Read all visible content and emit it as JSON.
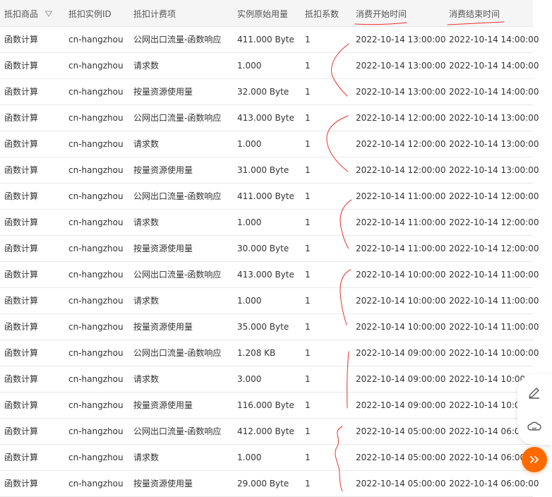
{
  "table": {
    "columns": [
      {
        "key": "product",
        "label": "抵扣商品"
      },
      {
        "key": "instance",
        "label": "抵扣实例ID"
      },
      {
        "key": "item",
        "label": "抵扣计费项"
      },
      {
        "key": "usage",
        "label": "实例原始用量"
      },
      {
        "key": "coef",
        "label": "抵扣系数"
      },
      {
        "key": "start",
        "label": "消费开始时间"
      },
      {
        "key": "end",
        "label": "消费结束时间"
      }
    ],
    "rows": [
      [
        "函数计算",
        "cn-hangzhou",
        "公网出口流量-函数响应",
        "411.000 Byte",
        "1",
        "2022-10-14 13:00:00",
        "2022-10-14 14:00:00"
      ],
      [
        "函数计算",
        "cn-hangzhou",
        "请求数",
        "1.000",
        "1",
        "2022-10-14 13:00:00",
        "2022-10-14 14:00:00"
      ],
      [
        "函数计算",
        "cn-hangzhou",
        "按量资源使用量",
        "32.000 Byte",
        "1",
        "2022-10-14 13:00:00",
        "2022-10-14 14:00:00"
      ],
      [
        "函数计算",
        "cn-hangzhou",
        "公网出口流量-函数响应",
        "413.000 Byte",
        "1",
        "2022-10-14 12:00:00",
        "2022-10-14 13:00:00"
      ],
      [
        "函数计算",
        "cn-hangzhou",
        "请求数",
        "1.000",
        "1",
        "2022-10-14 12:00:00",
        "2022-10-14 13:00:00"
      ],
      [
        "函数计算",
        "cn-hangzhou",
        "按量资源使用量",
        "31.000 Byte",
        "1",
        "2022-10-14 12:00:00",
        "2022-10-14 13:00:00"
      ],
      [
        "函数计算",
        "cn-hangzhou",
        "公网出口流量-函数响应",
        "411.000 Byte",
        "1",
        "2022-10-14 11:00:00",
        "2022-10-14 12:00:00"
      ],
      [
        "函数计算",
        "cn-hangzhou",
        "请求数",
        "1.000",
        "1",
        "2022-10-14 11:00:00",
        "2022-10-14 12:00:00"
      ],
      [
        "函数计算",
        "cn-hangzhou",
        "按量资源使用量",
        "30.000 Byte",
        "1",
        "2022-10-14 11:00:00",
        "2022-10-14 12:00:00"
      ],
      [
        "函数计算",
        "cn-hangzhou",
        "公网出口流量-函数响应",
        "413.000 Byte",
        "1",
        "2022-10-14 10:00:00",
        "2022-10-14 11:00:00"
      ],
      [
        "函数计算",
        "cn-hangzhou",
        "请求数",
        "1.000",
        "1",
        "2022-10-14 10:00:00",
        "2022-10-14 11:00:00"
      ],
      [
        "函数计算",
        "cn-hangzhou",
        "按量资源使用量",
        "35.000 Byte",
        "1",
        "2022-10-14 10:00:00",
        "2022-10-14 11:00:00"
      ],
      [
        "函数计算",
        "cn-hangzhou",
        "公网出口流量-函数响应",
        "1.208 KB",
        "1",
        "2022-10-14 09:00:00",
        "2022-10-14 10:00:00"
      ],
      [
        "函数计算",
        "cn-hangzhou",
        "请求数",
        "3.000",
        "1",
        "2022-10-14 09:00:00",
        "2022-10-14 10:00:00"
      ],
      [
        "函数计算",
        "cn-hangzhou",
        "按量资源使用量",
        "116.000 Byte",
        "1",
        "2022-10-14 09:00:00",
        "2022-10-14 10:00:00"
      ],
      [
        "函数计算",
        "cn-hangzhou",
        "公网出口流量-函数响应",
        "412.000 Byte",
        "1",
        "2022-10-14 05:00:00",
        "2022-10-14 06:00:00"
      ],
      [
        "函数计算",
        "cn-hangzhou",
        "请求数",
        "1.000",
        "1",
        "2022-10-14 05:00:00",
        "2022-10-14 06:00:00"
      ],
      [
        "函数计算",
        "cn-hangzhou",
        "按量资源使用量",
        "29.000 Byte",
        "1",
        "2022-10-14 05:00:00",
        "2022-10-14 06:00:00"
      ]
    ]
  },
  "icons": {
    "filter": "filter-icon",
    "edit": "edit-icon",
    "feedback": "cloud-feedback-icon",
    "expand": "double-chevron-right-icon"
  },
  "colors": {
    "header_bg": "#f5f5f6",
    "annotation": "#e8322c",
    "accent": "#ff6a00"
  }
}
